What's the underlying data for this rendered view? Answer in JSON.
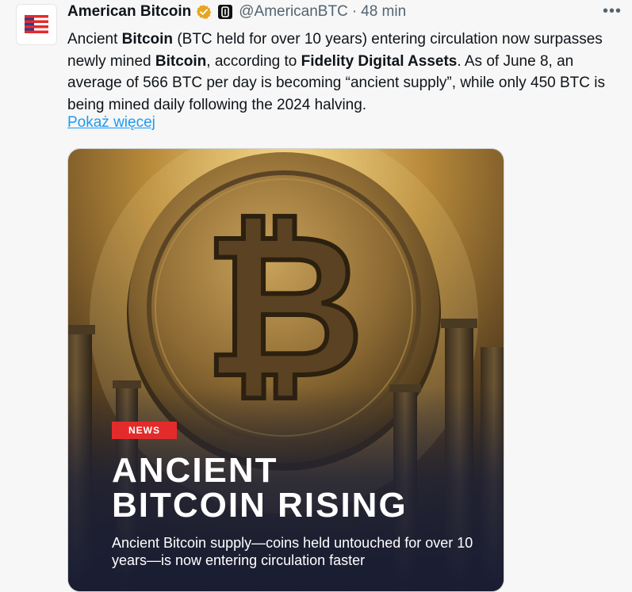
{
  "post": {
    "author_name": "American Bitcoin",
    "handle": "@AmericanBTC",
    "separator": "·",
    "time": "48 min",
    "more_label": "•••",
    "text_segments": [
      "Ancient ",
      "Bitcoin",
      " (BTC held for over 10 years) entering circulation now surpasses newly mined ",
      "Bitcoin",
      ", according to ",
      "Fidelity Digital Assets",
      ". As of June 8, an average of 566 BTC per day is becoming “ancient supply”, while only 450 BTC is being mined daily following the 2024 halving."
    ],
    "show_more": "Pokaż więcej"
  },
  "media": {
    "badge": "NEWS",
    "headline_line1": "ANCIENT",
    "headline_line2": "BITCOIN RISING",
    "caption": "Ancient Bitcoin supply—coins held untouched for over 10 years—is now entering circulation faster",
    "coin_symbol": "₿"
  },
  "colors": {
    "verified_badge": "#e7a521",
    "link": "#1d9bf0",
    "news_badge": "#e32b2b",
    "avatar_stripes": "#e32b2b",
    "avatar_navy": "#2a3d8f"
  },
  "icons": {
    "verified": "verified-badge-icon",
    "affiliate": "affiliate-bitcoin-icon",
    "more": "more-options-icon"
  }
}
